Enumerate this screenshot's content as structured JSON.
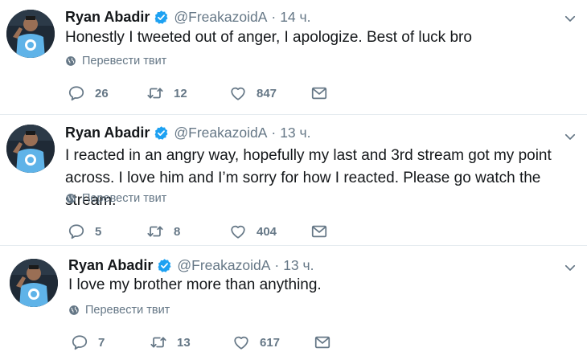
{
  "colors": {
    "text": "#14171a",
    "secondary": "#657786",
    "verified": "#1da1f2",
    "divider": "#e6ecf0"
  },
  "icons": {
    "verified": "verified-badge-icon",
    "reply": "reply-icon",
    "retweet": "retweet-icon",
    "like": "heart-icon",
    "dm": "envelope-icon",
    "translate": "globe-icon",
    "caret": "chevron-down-icon"
  },
  "tweets": [
    {
      "name": "Ryan Abadir",
      "handle": "@FreakazoidA",
      "separator": "·",
      "time": "14 ч.",
      "text": "Honestly I tweeted out of anger, I apologize. Best of luck bro",
      "translate": "Перевести твит",
      "replies": "26",
      "retweets": "12",
      "likes": "847"
    },
    {
      "name": "Ryan Abadir",
      "handle": "@FreakazoidA",
      "separator": "·",
      "time": "13 ч.",
      "text": "I reacted in an angry way, hopefully my last and 3rd stream got my point across. I love him and I’m sorry for how I reacted. Please go watch the stream.",
      "translate": "Перевести твит",
      "replies": "5",
      "retweets": "8",
      "likes": "404"
    },
    {
      "name": "Ryan Abadir",
      "handle": "@FreakazoidA",
      "separator": "·",
      "time": "13 ч.",
      "text": "I love my brother more than anything.",
      "translate": "Перевести твит",
      "replies": "7",
      "retweets": "13",
      "likes": "617"
    }
  ]
}
